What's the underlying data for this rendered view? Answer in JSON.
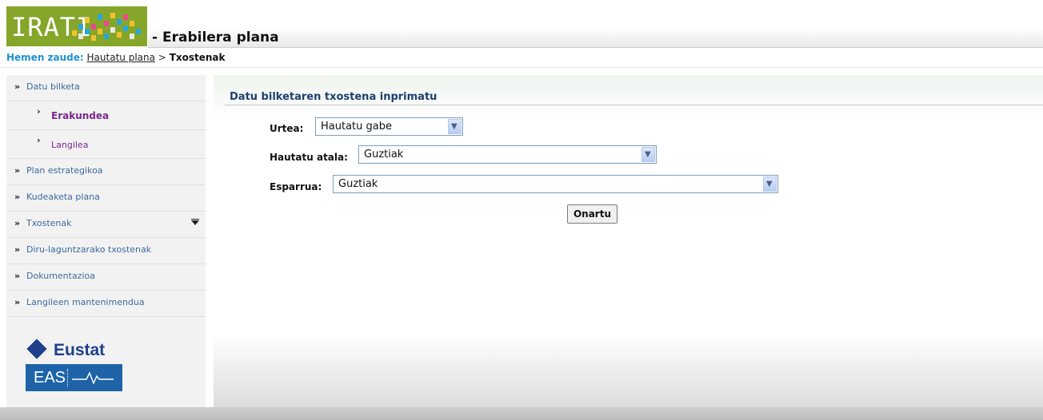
{
  "header": {
    "logo_text": "IRATI",
    "app_title": "- Erabilera plana"
  },
  "breadcrumb": {
    "prefix": "Hemen zaude:",
    "link": "Hautatu plana",
    "separator": ">",
    "current": "Txostenak"
  },
  "sidebar": {
    "items": [
      {
        "label": "Datu bilketa",
        "arrow": "»"
      },
      {
        "label": "Erakundea",
        "arrow": "›"
      },
      {
        "label": "Langilea",
        "arrow": "›"
      },
      {
        "label": "Plan estrategikoa",
        "arrow": "»"
      },
      {
        "label": "Kudeaketa plana",
        "arrow": "»"
      },
      {
        "label": "Txostenak",
        "arrow": "»"
      },
      {
        "label": "Diru-laguntzarako txostenak",
        "arrow": "»"
      },
      {
        "label": "Dokumentazioa",
        "arrow": "»"
      },
      {
        "label": "Langileen mantenimendua",
        "arrow": "»"
      }
    ],
    "logos": {
      "eustat": "Eustat",
      "eas": "EAS"
    }
  },
  "main": {
    "title": "Datu bilketaren txostena inprimatu",
    "fields": {
      "urtea": {
        "label": "Urtea:",
        "value": "Hautatu gabe"
      },
      "atala": {
        "label": "Hautatu atala:",
        "value": "Guztiak"
      },
      "esparrua": {
        "label": "Esparrua:",
        "value": "Guztiak"
      }
    },
    "submit_label": "Onartu"
  },
  "colors": {
    "brand_green": "#86a62a",
    "breadcrumb_blue": "#1f93d2",
    "submenu_purple": "#7a2a8c",
    "eustat_blue": "#1e3f8b"
  }
}
